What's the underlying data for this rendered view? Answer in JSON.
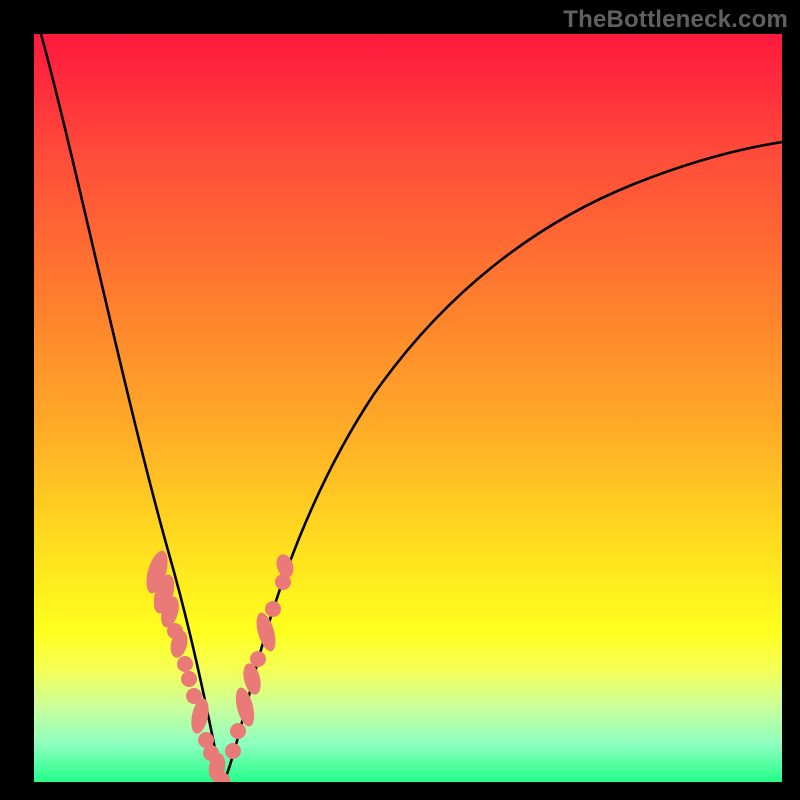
{
  "watermark": "TheBottleneck.com",
  "chart_data": {
    "type": "line",
    "title": "",
    "xlabel": "",
    "ylabel": "",
    "ylim": [
      0,
      100
    ],
    "xlim": [
      0,
      100
    ],
    "series": [
      {
        "name": "curve_left",
        "x": [
          1,
          3,
          5,
          7,
          9,
          12,
          14,
          16,
          18,
          20,
          22,
          24
        ],
        "values": [
          100,
          89,
          79,
          69,
          59,
          44,
          35,
          25,
          16,
          8,
          3,
          0
        ]
      },
      {
        "name": "curve_right",
        "x": [
          25,
          27,
          29,
          31,
          34,
          38,
          42,
          48,
          55,
          64,
          74,
          86,
          100
        ],
        "values": [
          0,
          8,
          17,
          26,
          36,
          46,
          54,
          62,
          68,
          74,
          79,
          83,
          86
        ]
      },
      {
        "name": "markers_left",
        "x": [
          16.5,
          17.2,
          17.8,
          18.4,
          18.6,
          19.2,
          19.6,
          20.0,
          20.5,
          21.6,
          22.5,
          23.2,
          23.4,
          24.4,
          25.0
        ],
        "values": [
          28.0,
          25.7,
          23.6,
          21.1,
          20.2,
          18.1,
          16.5,
          14.7,
          12.8,
          8.6,
          5.3,
          3.4,
          3.0,
          1.0,
          0.0
        ]
      },
      {
        "name": "markers_right",
        "x": [
          26.4,
          27.0,
          27.5,
          28.6,
          29.3,
          29.6,
          30.4,
          30.9,
          31.2,
          33.0
        ],
        "values": [
          4.3,
          7.1,
          9.3,
          13.4,
          15.7,
          16.7,
          19.7,
          21.5,
          22.5,
          29.0
        ]
      }
    ],
    "marker_color": "#e97a78",
    "curve_color": "#000000"
  }
}
